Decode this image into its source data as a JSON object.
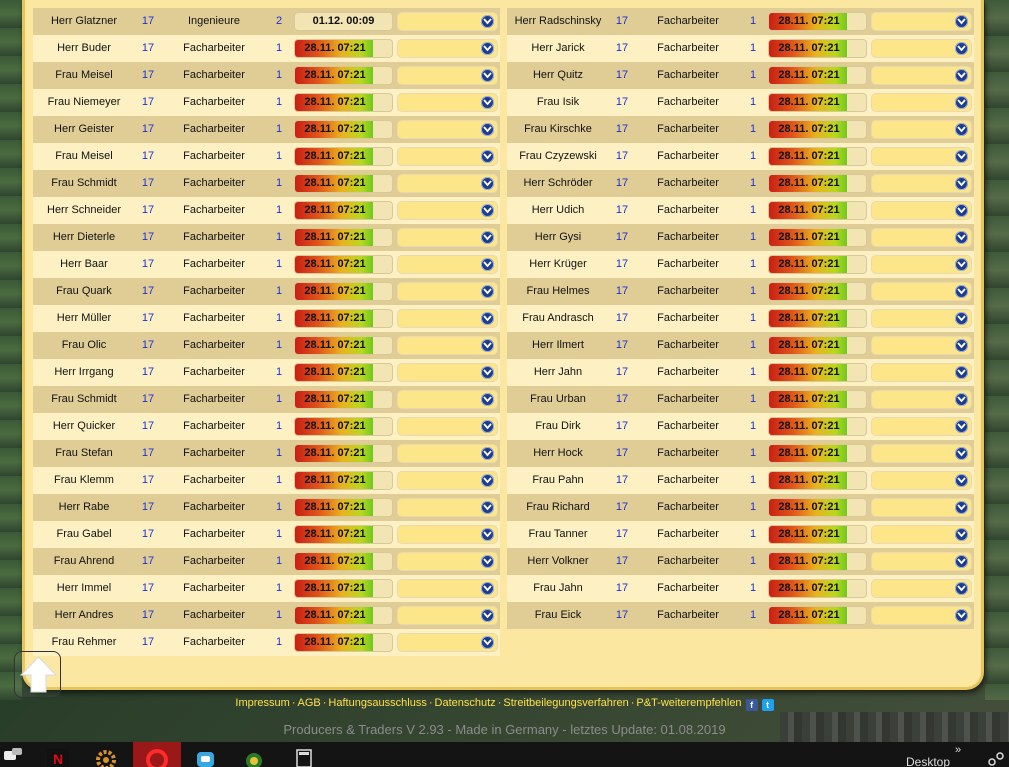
{
  "left_rows": [
    {
      "name": "Herr Glatzner",
      "level": "17",
      "job": "Ingenieure",
      "qty": "2",
      "date": "01.12. 00:09",
      "progress": 0
    },
    {
      "name": "Herr Buder",
      "level": "17",
      "job": "Facharbeiter",
      "qty": "1",
      "date": "28.11. 07:21",
      "progress": 0.8
    },
    {
      "name": "Frau Meisel",
      "level": "17",
      "job": "Facharbeiter",
      "qty": "1",
      "date": "28.11. 07:21",
      "progress": 0.8
    },
    {
      "name": "Frau Niemeyer",
      "level": "17",
      "job": "Facharbeiter",
      "qty": "1",
      "date": "28.11. 07:21",
      "progress": 0.8
    },
    {
      "name": "Herr Geister",
      "level": "17",
      "job": "Facharbeiter",
      "qty": "1",
      "date": "28.11. 07:21",
      "progress": 0.8
    },
    {
      "name": "Frau Meisel",
      "level": "17",
      "job": "Facharbeiter",
      "qty": "1",
      "date": "28.11. 07:21",
      "progress": 0.8
    },
    {
      "name": "Frau Schmidt",
      "level": "17",
      "job": "Facharbeiter",
      "qty": "1",
      "date": "28.11. 07:21",
      "progress": 0.8
    },
    {
      "name": "Herr Schneider",
      "level": "17",
      "job": "Facharbeiter",
      "qty": "1",
      "date": "28.11. 07:21",
      "progress": 0.8
    },
    {
      "name": "Herr Dieterle",
      "level": "17",
      "job": "Facharbeiter",
      "qty": "1",
      "date": "28.11. 07:21",
      "progress": 0.8
    },
    {
      "name": "Herr Baar",
      "level": "17",
      "job": "Facharbeiter",
      "qty": "1",
      "date": "28.11. 07:21",
      "progress": 0.8
    },
    {
      "name": "Frau Quark",
      "level": "17",
      "job": "Facharbeiter",
      "qty": "1",
      "date": "28.11. 07:21",
      "progress": 0.8
    },
    {
      "name": "Herr Müller",
      "level": "17",
      "job": "Facharbeiter",
      "qty": "1",
      "date": "28.11. 07:21",
      "progress": 0.8
    },
    {
      "name": "Frau Olic",
      "level": "17",
      "job": "Facharbeiter",
      "qty": "1",
      "date": "28.11. 07:21",
      "progress": 0.8
    },
    {
      "name": "Herr Irrgang",
      "level": "17",
      "job": "Facharbeiter",
      "qty": "1",
      "date": "28.11. 07:21",
      "progress": 0.8
    },
    {
      "name": "Frau Schmidt",
      "level": "17",
      "job": "Facharbeiter",
      "qty": "1",
      "date": "28.11. 07:21",
      "progress": 0.8
    },
    {
      "name": "Herr Quicker",
      "level": "17",
      "job": "Facharbeiter",
      "qty": "1",
      "date": "28.11. 07:21",
      "progress": 0.8
    },
    {
      "name": "Frau Stefan",
      "level": "17",
      "job": "Facharbeiter",
      "qty": "1",
      "date": "28.11. 07:21",
      "progress": 0.8
    },
    {
      "name": "Frau Klemm",
      "level": "17",
      "job": "Facharbeiter",
      "qty": "1",
      "date": "28.11. 07:21",
      "progress": 0.8
    },
    {
      "name": "Herr Rabe",
      "level": "17",
      "job": "Facharbeiter",
      "qty": "1",
      "date": "28.11. 07:21",
      "progress": 0.8
    },
    {
      "name": "Frau Gabel",
      "level": "17",
      "job": "Facharbeiter",
      "qty": "1",
      "date": "28.11. 07:21",
      "progress": 0.8
    },
    {
      "name": "Frau Ahrend",
      "level": "17",
      "job": "Facharbeiter",
      "qty": "1",
      "date": "28.11. 07:21",
      "progress": 0.8
    },
    {
      "name": "Herr Immel",
      "level": "17",
      "job": "Facharbeiter",
      "qty": "1",
      "date": "28.11. 07:21",
      "progress": 0.8
    },
    {
      "name": "Herr Andres",
      "level": "17",
      "job": "Facharbeiter",
      "qty": "1",
      "date": "28.11. 07:21",
      "progress": 0.8
    },
    {
      "name": "Frau Rehmer",
      "level": "17",
      "job": "Facharbeiter",
      "qty": "1",
      "date": "28.11. 07:21",
      "progress": 0.8
    }
  ],
  "right_rows": [
    {
      "name": "Herr Radschinsky",
      "level": "17",
      "job": "Facharbeiter",
      "qty": "1",
      "date": "28.11. 07:21",
      "progress": 0.8
    },
    {
      "name": "Herr Jarick",
      "level": "17",
      "job": "Facharbeiter",
      "qty": "1",
      "date": "28.11. 07:21",
      "progress": 0.8
    },
    {
      "name": "Herr Quitz",
      "level": "17",
      "job": "Facharbeiter",
      "qty": "1",
      "date": "28.11. 07:21",
      "progress": 0.8
    },
    {
      "name": "Frau Isik",
      "level": "17",
      "job": "Facharbeiter",
      "qty": "1",
      "date": "28.11. 07:21",
      "progress": 0.8
    },
    {
      "name": "Frau Kirschke",
      "level": "17",
      "job": "Facharbeiter",
      "qty": "1",
      "date": "28.11. 07:21",
      "progress": 0.8
    },
    {
      "name": "Frau Czyzewski",
      "level": "17",
      "job": "Facharbeiter",
      "qty": "1",
      "date": "28.11. 07:21",
      "progress": 0.8
    },
    {
      "name": "Herr Schröder",
      "level": "17",
      "job": "Facharbeiter",
      "qty": "1",
      "date": "28.11. 07:21",
      "progress": 0.8
    },
    {
      "name": "Herr Udich",
      "level": "17",
      "job": "Facharbeiter",
      "qty": "1",
      "date": "28.11. 07:21",
      "progress": 0.8
    },
    {
      "name": "Herr Gysi",
      "level": "17",
      "job": "Facharbeiter",
      "qty": "1",
      "date": "28.11. 07:21",
      "progress": 0.8
    },
    {
      "name": "Herr Krüger",
      "level": "17",
      "job": "Facharbeiter",
      "qty": "1",
      "date": "28.11. 07:21",
      "progress": 0.8
    },
    {
      "name": "Frau Helmes",
      "level": "17",
      "job": "Facharbeiter",
      "qty": "1",
      "date": "28.11. 07:21",
      "progress": 0.8
    },
    {
      "name": "Frau Andrasch",
      "level": "17",
      "job": "Facharbeiter",
      "qty": "1",
      "date": "28.11. 07:21",
      "progress": 0.8
    },
    {
      "name": "Herr Ilmert",
      "level": "17",
      "job": "Facharbeiter",
      "qty": "1",
      "date": "28.11. 07:21",
      "progress": 0.8
    },
    {
      "name": "Herr Jahn",
      "level": "17",
      "job": "Facharbeiter",
      "qty": "1",
      "date": "28.11. 07:21",
      "progress": 0.8
    },
    {
      "name": "Frau Urban",
      "level": "17",
      "job": "Facharbeiter",
      "qty": "1",
      "date": "28.11. 07:21",
      "progress": 0.8
    },
    {
      "name": "Frau Dirk",
      "level": "17",
      "job": "Facharbeiter",
      "qty": "1",
      "date": "28.11. 07:21",
      "progress": 0.8
    },
    {
      "name": "Herr Hock",
      "level": "17",
      "job": "Facharbeiter",
      "qty": "1",
      "date": "28.11. 07:21",
      "progress": 0.8
    },
    {
      "name": "Frau Pahn",
      "level": "17",
      "job": "Facharbeiter",
      "qty": "1",
      "date": "28.11. 07:21",
      "progress": 0.8
    },
    {
      "name": "Frau Richard",
      "level": "17",
      "job": "Facharbeiter",
      "qty": "1",
      "date": "28.11. 07:21",
      "progress": 0.8
    },
    {
      "name": "Frau Tanner",
      "level": "17",
      "job": "Facharbeiter",
      "qty": "1",
      "date": "28.11. 07:21",
      "progress": 0.8
    },
    {
      "name": "Herr Volkner",
      "level": "17",
      "job": "Facharbeiter",
      "qty": "1",
      "date": "28.11. 07:21",
      "progress": 0.8
    },
    {
      "name": "Frau Jahn",
      "level": "17",
      "job": "Facharbeiter",
      "qty": "1",
      "date": "28.11. 07:21",
      "progress": 0.8
    },
    {
      "name": "Frau Eick",
      "level": "17",
      "job": "Facharbeiter",
      "qty": "1",
      "date": "28.11. 07:21",
      "progress": 0.8
    }
  ],
  "footer": {
    "links": [
      "Impressum",
      "AGB",
      "Haftungsausschluss",
      "Datenschutz",
      "Streitbeilegungsverfahren",
      "P&T-weiterempfehlen"
    ],
    "separator": "·",
    "facebook_glyph": "f",
    "twitter_glyph": "t",
    "version": "Producers & Traders V 2.93 - Made in Germany - letztes Update: 01.08.2019"
  },
  "taskbar": {
    "desktop_label": "Desktop",
    "overflow_glyph": "»",
    "netflix_glyph": "N"
  },
  "icons": {
    "scroll_up": "arrow-up-icon",
    "select": "chevron-down-icon"
  },
  "colors": {
    "panel": "#fbe7a0",
    "row_odd": "#e0cd95",
    "row_even": "#fdf1c3",
    "number_blue": "#1a2fd8",
    "footer_link": "#ffe14d"
  }
}
